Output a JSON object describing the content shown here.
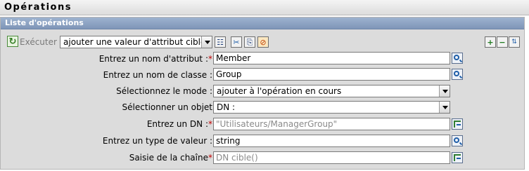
{
  "section": {
    "title": "Opérations"
  },
  "panel": {
    "title": "Liste d'opérations"
  },
  "toolbar": {
    "execute_label": "Exécuter",
    "action_select_value": "ajouter une valeur d'attribut cible"
  },
  "form": {
    "fields": [
      {
        "label": "Entrez un nom d'attribut :",
        "required": "*",
        "value": "Member",
        "placeholder": "",
        "control": "input",
        "button_icon": "search-icon"
      },
      {
        "label": "Entrez un nom de classe :",
        "required": "",
        "value": "Group",
        "placeholder": "",
        "control": "input",
        "button_icon": "search-icon"
      },
      {
        "label": "Sélectionnez le mode :",
        "required": "",
        "value": "ajouter à l'opération en cours",
        "placeholder": "",
        "control": "select",
        "button_icon": ""
      },
      {
        "label": "Sélectionner un objet",
        "required": "",
        "value": "DN :",
        "placeholder": "",
        "control": "select",
        "button_icon": ""
      },
      {
        "label": "Entrez un DN :",
        "required": "*",
        "value": "",
        "placeholder": "\"Utilisateurs/ManagerGroup\"",
        "control": "input",
        "button_icon": "argument-builder-icon"
      },
      {
        "label": "Entrez un type de valeur :",
        "required": "",
        "value": "string",
        "placeholder": "",
        "control": "input",
        "button_icon": "search-icon"
      },
      {
        "label": "Saisie de la chaîne",
        "required": "*",
        "value": "",
        "placeholder": "DN cible()",
        "control": "input",
        "button_icon": "argument-builder-icon"
      }
    ]
  },
  "colors": {
    "panel_header": "#8aa0c0",
    "panel_bg": "#dcdcdc",
    "required_mark": "#c00000"
  }
}
